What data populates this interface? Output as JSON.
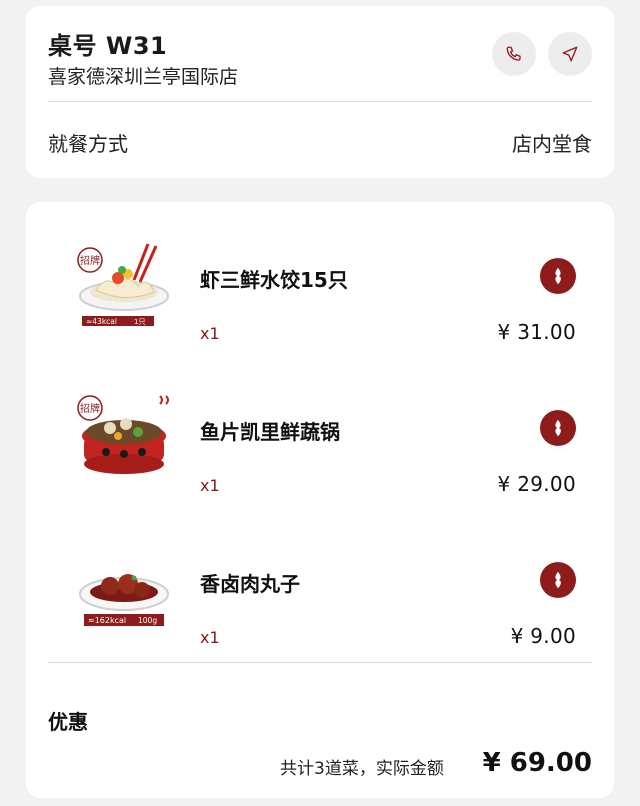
{
  "header": {
    "table_number": "桌号 W31",
    "store_name": "喜家德深圳兰亭国际店",
    "call_icon": "phone-icon",
    "nav_icon": "navigation-arrow-icon"
  },
  "dining": {
    "label": "就餐方式",
    "value": "店内堂食"
  },
  "items": [
    {
      "name": "虾三鲜水饺15只",
      "quantity": "x1",
      "price": "¥ 31.00",
      "badge_text": "招牌",
      "calorie_text": "≈43kcal",
      "calorie_unit": "1只"
    },
    {
      "name": "鱼片凯里鲜蔬锅",
      "quantity": "x1",
      "price": "¥ 29.00",
      "badge_text": "招牌"
    },
    {
      "name": "香卤肉丸子",
      "quantity": "x1",
      "price": "¥ 9.00",
      "calorie_text": "≈162kcal",
      "calorie_unit": "100g"
    }
  ],
  "summary": {
    "discount_label": "优惠",
    "summary_text": "共计3道菜，实际金额",
    "total": "¥ 69.00"
  },
  "colors": {
    "brand_red": "#8e1c1c",
    "qty_red": "#8b1a1a",
    "page_bg": "#f3f3f3"
  }
}
